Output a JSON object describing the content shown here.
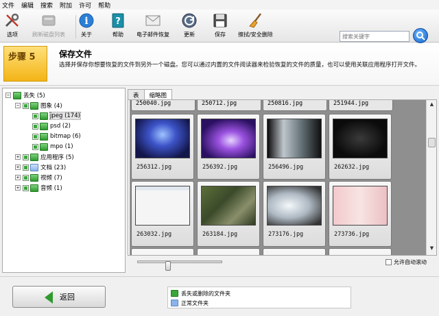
{
  "menu": [
    "文件",
    "编辑",
    "搜索",
    "附加",
    "许可",
    "帮助"
  ],
  "toolbar": {
    "items": [
      {
        "label": "选项",
        "icon": "tools-icon"
      },
      {
        "label": "刷新磁盘列表",
        "icon": "refresh-disk-icon",
        "disabled": true
      },
      {
        "label": "关于",
        "icon": "info-icon"
      },
      {
        "label": "帮助",
        "icon": "help-book-icon"
      },
      {
        "label": "电子邮件恢复",
        "icon": "envelope-icon"
      },
      {
        "label": "更新",
        "icon": "update-icon"
      },
      {
        "label": "保存",
        "icon": "floppy-icon"
      },
      {
        "label": "擦拭/安全删除",
        "icon": "broom-icon"
      }
    ],
    "search_placeholder": "搜索关键字"
  },
  "step": {
    "label": "步骤 5",
    "title": "保存文件",
    "description": "选择并保存你想要恢复的文件到另外一个磁盘。您可以通过内置的文件阅读器来检验恢复的文件的质量，也可以使用关联应用程序打开文件。"
  },
  "tree": {
    "root": "丢失 (5)",
    "images": "图象 (4)",
    "jpeg": "jpeg (174)",
    "psd": "psd (2)",
    "bitmap": "bitmap (6)",
    "mpo": "mpo (1)",
    "apps": "应用程序 (5)",
    "docs": "文档 (23)",
    "video": "视频 (7)",
    "audio": "音频 (1)"
  },
  "tabs": [
    "表",
    "缩略图"
  ],
  "thumbnails": {
    "top_row": [
      "250040.jpg",
      "250712.jpg",
      "250816.jpg",
      "251944.jpg"
    ],
    "row1": [
      "256312.jpg",
      "256392.jpg",
      "256496.jpg",
      "262632.jpg"
    ],
    "row2": [
      "263032.jpg",
      "263184.jpg",
      "273176.jpg",
      "273736.jpg"
    ]
  },
  "auto_scroll_label": "允许自动滚动",
  "footer": {
    "back_label": "返回",
    "legend": [
      {
        "label": "丢失或删除的文件夹",
        "color": "#3aa63a"
      },
      {
        "label": "正常文件夹",
        "color": "#8ab3ea"
      }
    ]
  }
}
